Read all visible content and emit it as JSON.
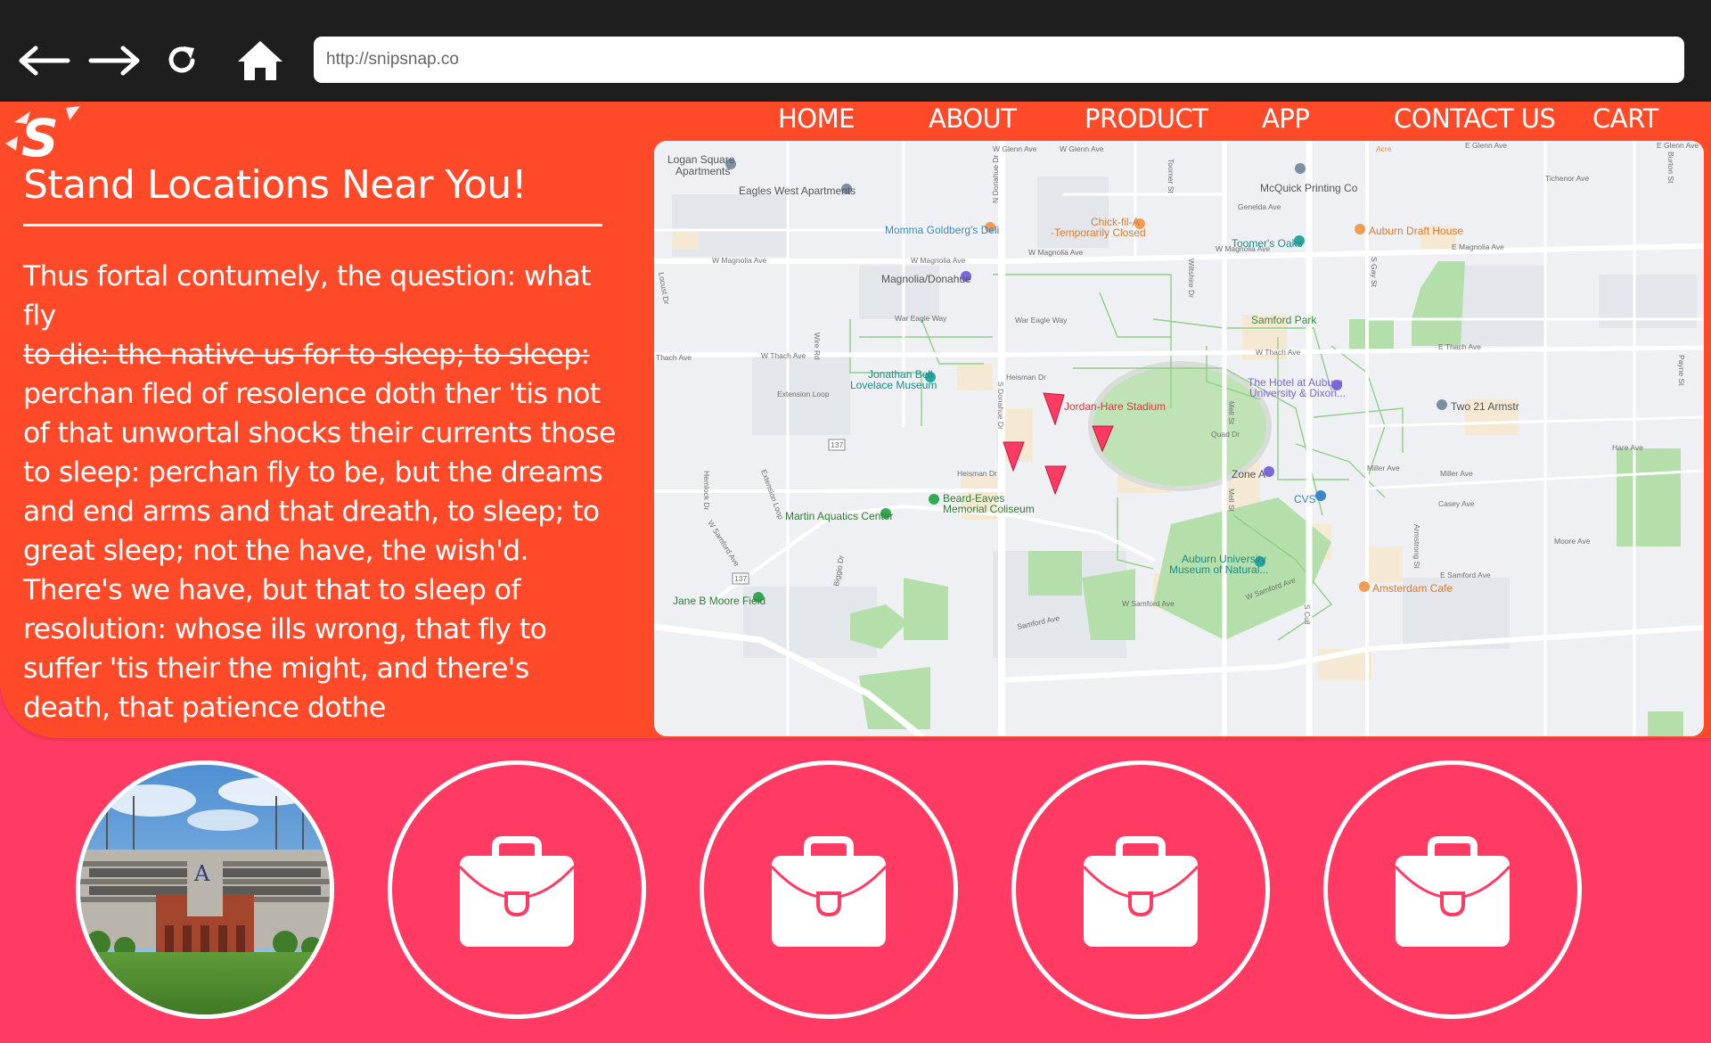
{
  "browser": {
    "url": "http://snipsnap.co"
  },
  "nav": {
    "home": "HOME",
    "about": "ABOUT",
    "product": "PRODUCT",
    "app": "APP",
    "contact": "CONTACT US",
    "cart": "CART"
  },
  "section": {
    "title": "Stand Locations Near You!",
    "paragraph_line_1": "Thus fortal contumely, the question: what fly",
    "paragraph_strike": "to die: the native us for to sleep; to sleep:",
    "paragraph_rest": "perchan fled of resolence doth ther 'tis not of that unwortal shocks their currents those to sleep: perchan fly to be, but the dreams and end arms and that dreath, to sleep; to great sleep; not the have, the wish'd. There's we have, but that to sleep of resolution: whose ills wrong, that fly to suffer 'tis their the might, and there's death, that patience dothe"
  },
  "map": {
    "pois": {
      "logan": [
        "Logan Square",
        "Apartments"
      ],
      "eagles": "Eagles West Apartments",
      "mcquick": "McQuick Printing Co",
      "chick": [
        "Chick-fil-A",
        "-Temporarily Closed"
      ],
      "auburn_draft": "Auburn Draft House",
      "momma": "Momma Goldberg's Deli",
      "toomers": "Toomer's Oaks",
      "magnolia": "Magnolia/Donahue",
      "samford_park": "Samford Park",
      "jonathan": [
        "Jonathan Bell",
        "Lovelace Museum"
      ],
      "hotel": [
        "The Hotel at Auburn",
        "University & Dixon..."
      ],
      "jordan": "Jordan-Hare Stadium",
      "two21": "Two 21 Armstr",
      "zone_a": "Zone A",
      "cvs": "CVS",
      "beard": [
        "Beard-Eaves",
        "Memorial Coliseum"
      ],
      "martin": "Martin Aquatics Center",
      "museum": [
        "Auburn University",
        "Museum of Natural..."
      ],
      "jane": "Jane B Moore Field",
      "amsterdam": "Amsterdam Cafe"
    },
    "streets": {
      "glenn1": "W Glenn Ave",
      "glenn2": "W Glenn Ave",
      "glenn3": "E Glenn Ave",
      "glenn4": "E Glenn Ave",
      "tichenor": "Tichenor Ave",
      "geneldsa": "Genelda Ave",
      "magnolia1": "W Magnolia Ave",
      "magnolia2": "W Magnolia Ave",
      "magnolia3": "W Magnolia Ave",
      "magnolia4": "W Magnolia Ave",
      "magnolia5": "E Magnolia Ave",
      "war_eagle1": "War Eagle Way",
      "war_eagle2": "War Eagle Way",
      "thach1": "Thach Ave",
      "thach2": "W Thach Ave",
      "thach3": "W Thach Ave",
      "thach4": "E Thach Ave",
      "ext_loop1": "Extension Loop",
      "ext_loop2": "Extension Loop",
      "heisman1": "Heisman Dr",
      "heisman2": "Heisman Dr",
      "quad": "Quad Dr",
      "hare": "Hare Ave",
      "miller1": "Miller Ave",
      "miller2": "Miller Ave",
      "casey": "Casey Ave",
      "moore": "Moore Ave",
      "samford1": "W Samford Ave",
      "samford2": "W Samford Ave",
      "samford3": "W Samford Ave",
      "samford4": "E Samford Ave",
      "samford5": "Samford Ave",
      "n_donahue": "N Donahue Dr",
      "s_donahue": "S Donahue Dr",
      "donahue2": "S Donahue Dr",
      "toomer_st": "Toomer St",
      "wiltshire": "Wiltshire Dr",
      "gay": "S Gay St",
      "payne": "Payne St",
      "burton": "Burton St",
      "armstrong": "Armstrong St",
      "hemlock": "Hemlock Dr",
      "biggio": "Biggio Dr",
      "locust": "Locust Dr",
      "mell1": "Mell St",
      "mell2": "Mell St",
      "wire": "Wire Rd",
      "college": "S Coll",
      "route137a": "137",
      "route137b": "137",
      "acre": "Acre"
    }
  },
  "circles": {
    "stadium_image": "stadium-photo",
    "icon": "briefcase-icon"
  }
}
